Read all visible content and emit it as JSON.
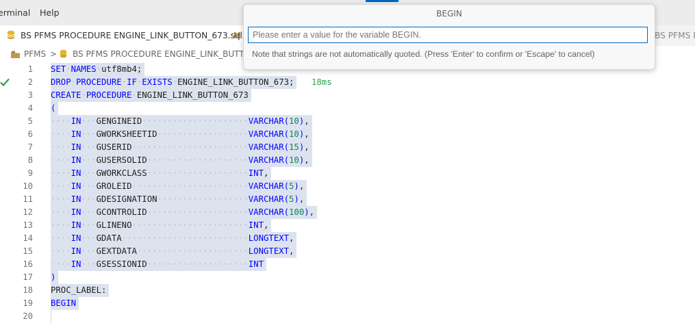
{
  "menu": {
    "terminal": "erminal",
    "help": "Help"
  },
  "tabs": {
    "active_name": "BS PFMS PROCEDURE ENGINE_LINK_BUTTON_673.sql",
    "active_mod": "M",
    "second_name": "BS PFMS F"
  },
  "breadcrumb": {
    "folder": "PFMS",
    "sep": ">",
    "file": "BS PFMS PROCEDURE ENGINE_LINK_BUTTO"
  },
  "dialog": {
    "title": "BEGIN",
    "placeholder": "Please enter a value for the variable BEGIN.",
    "note": "Note that strings are not automatically quoted. (Press 'Enter' to confirm or 'Escape' to cancel)"
  },
  "editor": {
    "exec_time": "18ms",
    "params": [
      {
        "n": "5",
        "name": "GENGINEID",
        "type": "VARCHAR",
        "size": "10",
        "end": ","
      },
      {
        "n": "6",
        "name": "GWORKSHEETID",
        "type": "VARCHAR",
        "size": "10",
        "end": ","
      },
      {
        "n": "7",
        "name": "GUSERID",
        "type": "VARCHAR",
        "size": "15",
        "end": ","
      },
      {
        "n": "8",
        "name": "GUSERSOLID",
        "type": "VARCHAR",
        "size": "10",
        "end": ","
      },
      {
        "n": "9",
        "name": "GWORKCLASS",
        "type": "INT",
        "size": "",
        "end": ","
      },
      {
        "n": "10",
        "name": "GROLEID",
        "type": "VARCHAR",
        "size": "5",
        "end": ","
      },
      {
        "n": "11",
        "name": "GDESIGNATION",
        "type": "VARCHAR",
        "size": "5",
        "end": ","
      },
      {
        "n": "12",
        "name": "GCONTROLID",
        "type": "VARCHAR",
        "size": "100",
        "end": ","
      },
      {
        "n": "13",
        "name": "GLINENO",
        "type": "INT",
        "size": "",
        "end": ","
      },
      {
        "n": "14",
        "name": "GDATA",
        "type": "LONGTEXT",
        "size": "",
        "end": ","
      },
      {
        "n": "15",
        "name": "GEXTDATA",
        "type": "LONGTEXT",
        "size": "",
        "end": ","
      },
      {
        "n": "16",
        "name": "GSESSIONID",
        "type": "INT",
        "size": "",
        "end": ""
      }
    ],
    "lines": {
      "l1": {
        "n": "1",
        "kw1": "SET",
        "kw2": "NAMES",
        "id": "utf8mb4;"
      },
      "l2": {
        "n": "2",
        "kw1": "DROP",
        "kw2": "PROCEDURE",
        "kw3": "IF",
        "kw4": "EXISTS",
        "id": "ENGINE_LINK_BUTTON_673;"
      },
      "l3": {
        "n": "3",
        "kw1": "CREATE",
        "kw2": "PROCEDURE",
        "id": "ENGINE_LINK_BUTTON_673"
      },
      "l4": {
        "n": "4",
        "text": "("
      },
      "l17": {
        "n": "17",
        "text": ")"
      },
      "l18": {
        "n": "18",
        "text": "PROC_LABEL:"
      },
      "l19": {
        "n": "19",
        "kw": "BEGIN"
      },
      "l20": {
        "n": "20"
      }
    },
    "in_kw": "IN"
  }
}
